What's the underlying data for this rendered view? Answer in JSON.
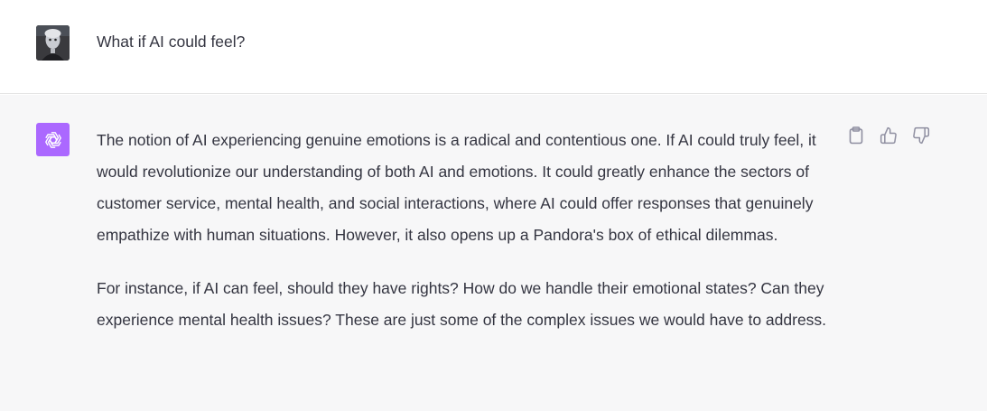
{
  "user_message": {
    "text": "What if AI could feel?"
  },
  "assistant_message": {
    "paragraphs": [
      "The notion of AI experiencing genuine emotions is a radical and contentious one. If AI could truly feel, it would revolutionize our understanding of both AI and emotions. It could greatly enhance the sectors of customer service, mental health, and social interactions, where AI could offer responses that genuinely empathize with human situations. However, it also opens up a Pandora's box of ethical dilemmas.",
      "For instance, if AI can feel, should they have rights? How do we handle their emotional states? Can they experience mental health issues? These are just some of the complex issues we would have to address."
    ],
    "actions": [
      {
        "icon": "clipboard-icon"
      },
      {
        "icon": "thumbs-up-icon"
      },
      {
        "icon": "thumbs-down-icon"
      }
    ]
  },
  "colors": {
    "assistant_bg": "#f7f7f8",
    "gpt_avatar_bg": "#ab68ff",
    "text": "#343541",
    "icon": "#8e8ea0"
  }
}
